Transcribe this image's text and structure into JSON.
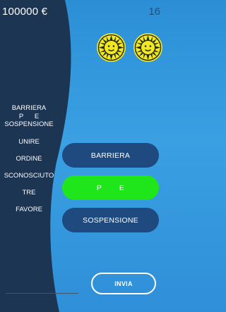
{
  "header": {
    "score": "100000 €",
    "level": "16"
  },
  "hints": {
    "medals": [
      {
        "icon": "sun-coin-icon"
      },
      {
        "icon": "sun-coin-icon"
      }
    ]
  },
  "word_list": {
    "target_lines": [
      "BARRIERA",
      "P      E",
      "SOSPENSIONE"
    ],
    "words": [
      "UNIRE",
      "ORDINE",
      "SCONOSCIUTO",
      "TRE",
      "FAVORE"
    ]
  },
  "answers": [
    {
      "label": "BARRIERA",
      "state": "normal"
    },
    {
      "label": "P        E",
      "state": "active"
    },
    {
      "label": "SOSPENSIONE",
      "state": "normal"
    }
  ],
  "actions": {
    "send_label": "INVIA"
  },
  "colors": {
    "background_blue": "#3aa0e2",
    "panel_dark": "#1c3553",
    "button_dark": "#1e4a7f",
    "button_active": "#1fe61a",
    "coin_yellow": "#f4e81c"
  }
}
